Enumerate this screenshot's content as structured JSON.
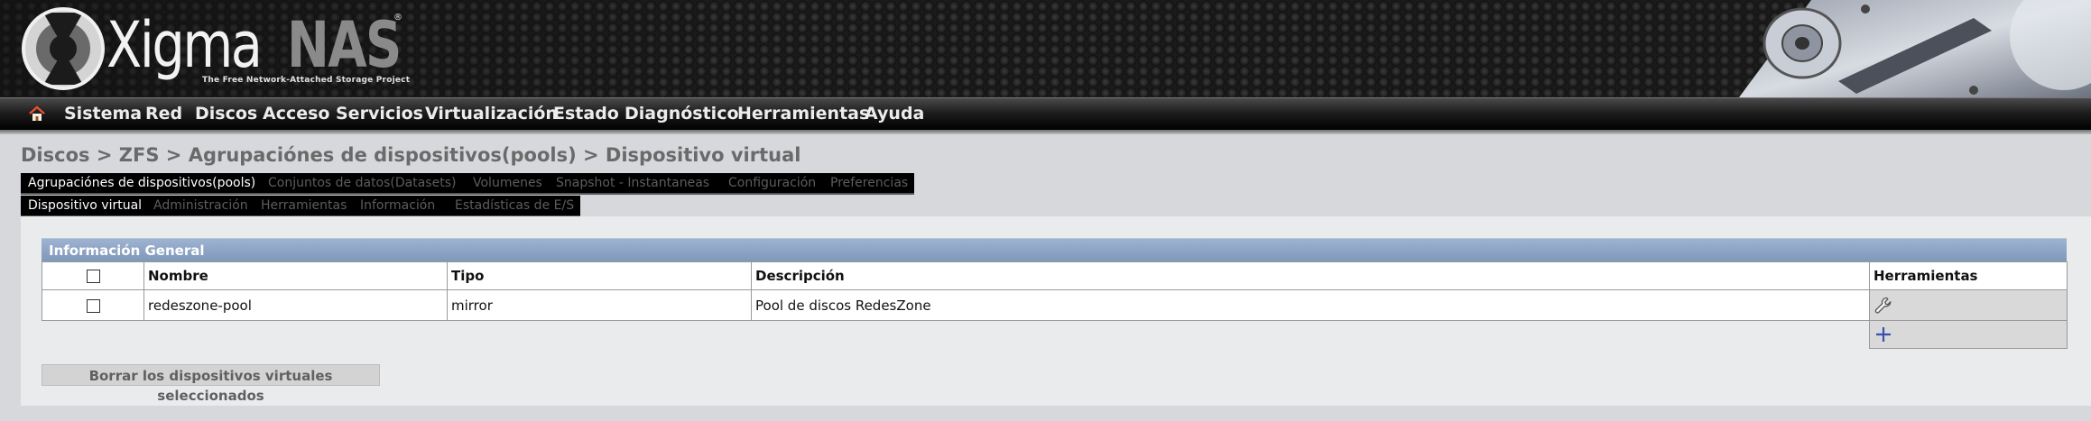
{
  "header": {
    "logo_xigma": "Xigma",
    "logo_nas": "NAS",
    "logo_registered": "®",
    "logo_tagline": "The Free Network-Attached Storage Project"
  },
  "nav": {
    "home_icon": "home-icon",
    "items": [
      "Sistema",
      "Red",
      "Discos",
      "Acceso",
      "Servicios",
      "Virtualización",
      "Estado",
      "Diagnóstico",
      "Herramientas",
      "Ayuda"
    ]
  },
  "breadcrumb": [
    "Discos",
    "ZFS",
    "Agrupaciónes de dispositivos(pools)",
    "Dispositivo virtual"
  ],
  "breadcrumb_separator": ">",
  "tabs_primary": [
    {
      "label": "Agrupaciónes de dispositivos(pools)",
      "active": true
    },
    {
      "label": "Conjuntos de datos(Datasets)",
      "active": false
    },
    {
      "label": "Volumenes",
      "active": false
    },
    {
      "label": "Snapshot - Instantaneas",
      "active": false
    },
    {
      "label": "Configuración",
      "active": false
    },
    {
      "label": "Preferencias",
      "active": false
    }
  ],
  "tabs_secondary": [
    {
      "label": "Dispositivo virtual",
      "active": true
    },
    {
      "label": "Administración",
      "active": false
    },
    {
      "label": "Herramientas",
      "active": false
    },
    {
      "label": "Información",
      "active": false
    },
    {
      "label": "Estadísticas de E/S",
      "active": false
    }
  ],
  "section": {
    "title": "Información General"
  },
  "table": {
    "columns": [
      "Nombre",
      "Tipo",
      "Descripción",
      "Herramientas"
    ],
    "rows": [
      {
        "checked": false,
        "name": "redeszone-pool",
        "type": "mirror",
        "description": "Pool de discos RedesZone",
        "tool_icon": "wrench-icon"
      }
    ],
    "add_icon": "plus-icon"
  },
  "actions": {
    "delete_selected_label": "Borrar los dispositivos virtuales seleccionados"
  },
  "colors": {
    "section_header": "#8ea3c5",
    "nav_text": "#ececec",
    "tab_inactive": "#5d5d5d",
    "panel_bg": "#eaebed",
    "page_bg": "#d6d8dc",
    "add_icon": "#3a4fb0"
  }
}
